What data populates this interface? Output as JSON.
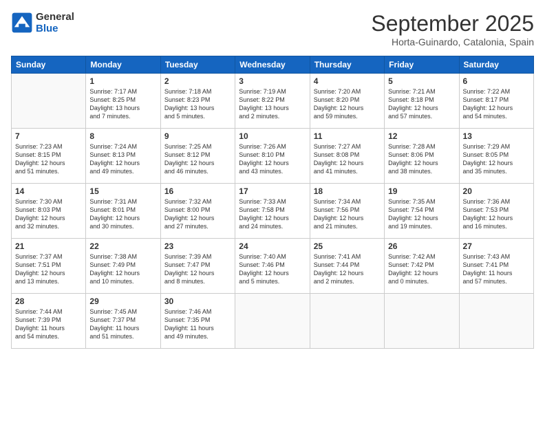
{
  "logo": {
    "line1": "General",
    "line2": "Blue"
  },
  "header": {
    "title": "September 2025",
    "subtitle": "Horta-Guinardo, Catalonia, Spain"
  },
  "weekdays": [
    "Sunday",
    "Monday",
    "Tuesday",
    "Wednesday",
    "Thursday",
    "Friday",
    "Saturday"
  ],
  "weeks": [
    [
      {
        "day": "",
        "lines": []
      },
      {
        "day": "1",
        "lines": [
          "Sunrise: 7:17 AM",
          "Sunset: 8:25 PM",
          "Daylight: 13 hours",
          "and 7 minutes."
        ]
      },
      {
        "day": "2",
        "lines": [
          "Sunrise: 7:18 AM",
          "Sunset: 8:23 PM",
          "Daylight: 13 hours",
          "and 5 minutes."
        ]
      },
      {
        "day": "3",
        "lines": [
          "Sunrise: 7:19 AM",
          "Sunset: 8:22 PM",
          "Daylight: 13 hours",
          "and 2 minutes."
        ]
      },
      {
        "day": "4",
        "lines": [
          "Sunrise: 7:20 AM",
          "Sunset: 8:20 PM",
          "Daylight: 12 hours",
          "and 59 minutes."
        ]
      },
      {
        "day": "5",
        "lines": [
          "Sunrise: 7:21 AM",
          "Sunset: 8:18 PM",
          "Daylight: 12 hours",
          "and 57 minutes."
        ]
      },
      {
        "day": "6",
        "lines": [
          "Sunrise: 7:22 AM",
          "Sunset: 8:17 PM",
          "Daylight: 12 hours",
          "and 54 minutes."
        ]
      }
    ],
    [
      {
        "day": "7",
        "lines": [
          "Sunrise: 7:23 AM",
          "Sunset: 8:15 PM",
          "Daylight: 12 hours",
          "and 51 minutes."
        ]
      },
      {
        "day": "8",
        "lines": [
          "Sunrise: 7:24 AM",
          "Sunset: 8:13 PM",
          "Daylight: 12 hours",
          "and 49 minutes."
        ]
      },
      {
        "day": "9",
        "lines": [
          "Sunrise: 7:25 AM",
          "Sunset: 8:12 PM",
          "Daylight: 12 hours",
          "and 46 minutes."
        ]
      },
      {
        "day": "10",
        "lines": [
          "Sunrise: 7:26 AM",
          "Sunset: 8:10 PM",
          "Daylight: 12 hours",
          "and 43 minutes."
        ]
      },
      {
        "day": "11",
        "lines": [
          "Sunrise: 7:27 AM",
          "Sunset: 8:08 PM",
          "Daylight: 12 hours",
          "and 41 minutes."
        ]
      },
      {
        "day": "12",
        "lines": [
          "Sunrise: 7:28 AM",
          "Sunset: 8:06 PM",
          "Daylight: 12 hours",
          "and 38 minutes."
        ]
      },
      {
        "day": "13",
        "lines": [
          "Sunrise: 7:29 AM",
          "Sunset: 8:05 PM",
          "Daylight: 12 hours",
          "and 35 minutes."
        ]
      }
    ],
    [
      {
        "day": "14",
        "lines": [
          "Sunrise: 7:30 AM",
          "Sunset: 8:03 PM",
          "Daylight: 12 hours",
          "and 32 minutes."
        ]
      },
      {
        "day": "15",
        "lines": [
          "Sunrise: 7:31 AM",
          "Sunset: 8:01 PM",
          "Daylight: 12 hours",
          "and 30 minutes."
        ]
      },
      {
        "day": "16",
        "lines": [
          "Sunrise: 7:32 AM",
          "Sunset: 8:00 PM",
          "Daylight: 12 hours",
          "and 27 minutes."
        ]
      },
      {
        "day": "17",
        "lines": [
          "Sunrise: 7:33 AM",
          "Sunset: 7:58 PM",
          "Daylight: 12 hours",
          "and 24 minutes."
        ]
      },
      {
        "day": "18",
        "lines": [
          "Sunrise: 7:34 AM",
          "Sunset: 7:56 PM",
          "Daylight: 12 hours",
          "and 21 minutes."
        ]
      },
      {
        "day": "19",
        "lines": [
          "Sunrise: 7:35 AM",
          "Sunset: 7:54 PM",
          "Daylight: 12 hours",
          "and 19 minutes."
        ]
      },
      {
        "day": "20",
        "lines": [
          "Sunrise: 7:36 AM",
          "Sunset: 7:53 PM",
          "Daylight: 12 hours",
          "and 16 minutes."
        ]
      }
    ],
    [
      {
        "day": "21",
        "lines": [
          "Sunrise: 7:37 AM",
          "Sunset: 7:51 PM",
          "Daylight: 12 hours",
          "and 13 minutes."
        ]
      },
      {
        "day": "22",
        "lines": [
          "Sunrise: 7:38 AM",
          "Sunset: 7:49 PM",
          "Daylight: 12 hours",
          "and 10 minutes."
        ]
      },
      {
        "day": "23",
        "lines": [
          "Sunrise: 7:39 AM",
          "Sunset: 7:47 PM",
          "Daylight: 12 hours",
          "and 8 minutes."
        ]
      },
      {
        "day": "24",
        "lines": [
          "Sunrise: 7:40 AM",
          "Sunset: 7:46 PM",
          "Daylight: 12 hours",
          "and 5 minutes."
        ]
      },
      {
        "day": "25",
        "lines": [
          "Sunrise: 7:41 AM",
          "Sunset: 7:44 PM",
          "Daylight: 12 hours",
          "and 2 minutes."
        ]
      },
      {
        "day": "26",
        "lines": [
          "Sunrise: 7:42 AM",
          "Sunset: 7:42 PM",
          "Daylight: 12 hours",
          "and 0 minutes."
        ]
      },
      {
        "day": "27",
        "lines": [
          "Sunrise: 7:43 AM",
          "Sunset: 7:41 PM",
          "Daylight: 11 hours",
          "and 57 minutes."
        ]
      }
    ],
    [
      {
        "day": "28",
        "lines": [
          "Sunrise: 7:44 AM",
          "Sunset: 7:39 PM",
          "Daylight: 11 hours",
          "and 54 minutes."
        ]
      },
      {
        "day": "29",
        "lines": [
          "Sunrise: 7:45 AM",
          "Sunset: 7:37 PM",
          "Daylight: 11 hours",
          "and 51 minutes."
        ]
      },
      {
        "day": "30",
        "lines": [
          "Sunrise: 7:46 AM",
          "Sunset: 7:35 PM",
          "Daylight: 11 hours",
          "and 49 minutes."
        ]
      },
      {
        "day": "",
        "lines": []
      },
      {
        "day": "",
        "lines": []
      },
      {
        "day": "",
        "lines": []
      },
      {
        "day": "",
        "lines": []
      }
    ]
  ]
}
